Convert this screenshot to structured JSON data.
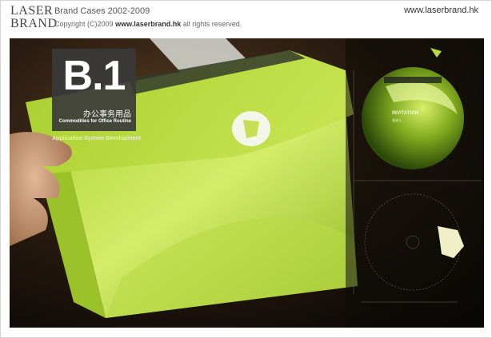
{
  "header": {
    "logo_line1": "LASER",
    "logo_line2": "BRAND",
    "title": "Brand Cases 2002-2009",
    "copyright_prefix": "Copyright (C)2009",
    "copyright_link": "www.laserbrand.hk",
    "copyright_suffix": "all rights reserved.",
    "site_url": "www.laserbrand.hk"
  },
  "case": {
    "code": "B.1",
    "title_cn": "办公事务用品",
    "title_en": "Commodities for Office Routine",
    "category": "Application System Development"
  },
  "photo": {
    "disc_label": "INVITATION",
    "disc_sub": "邀请卡",
    "accent_color": "#b8dc3a",
    "background_color": "#120d08",
    "badge_color": "#3a3a3a"
  }
}
